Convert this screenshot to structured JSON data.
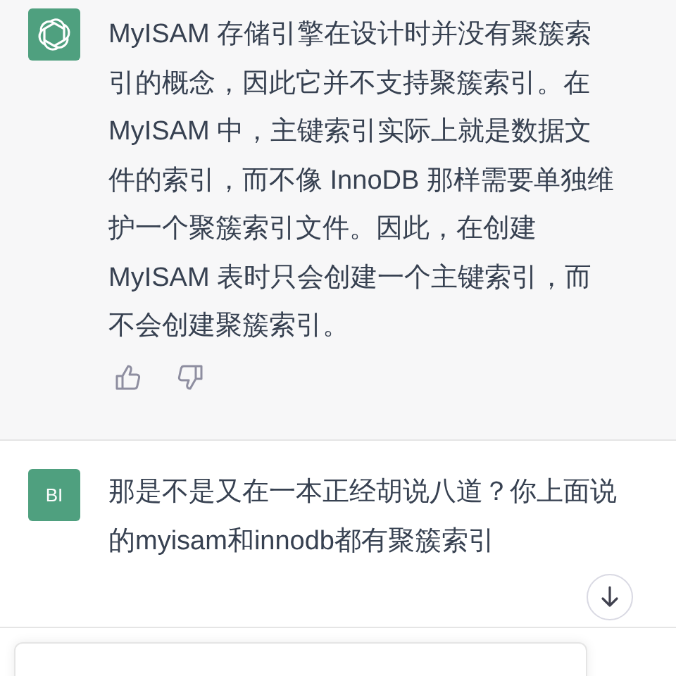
{
  "messages": [
    {
      "kind": "assistant",
      "text": "MyISAM 存储引擎在设计时并没有聚簇索引的概念，因此它并不支持聚簇索引。在 MyISAM 中，主键索引实际上就是数据文件的索引，而不像 InnoDB 那样需要单独维护一个聚簇索引文件。因此，在创建 MyISAM 表时只会创建一个主键索引，而不会创建聚簇索引。"
    },
    {
      "kind": "user",
      "avatar": "BI",
      "text": "那是不是又在一本正经胡说八道？你上面说的myisam和innodb都有聚簇索引"
    }
  ]
}
